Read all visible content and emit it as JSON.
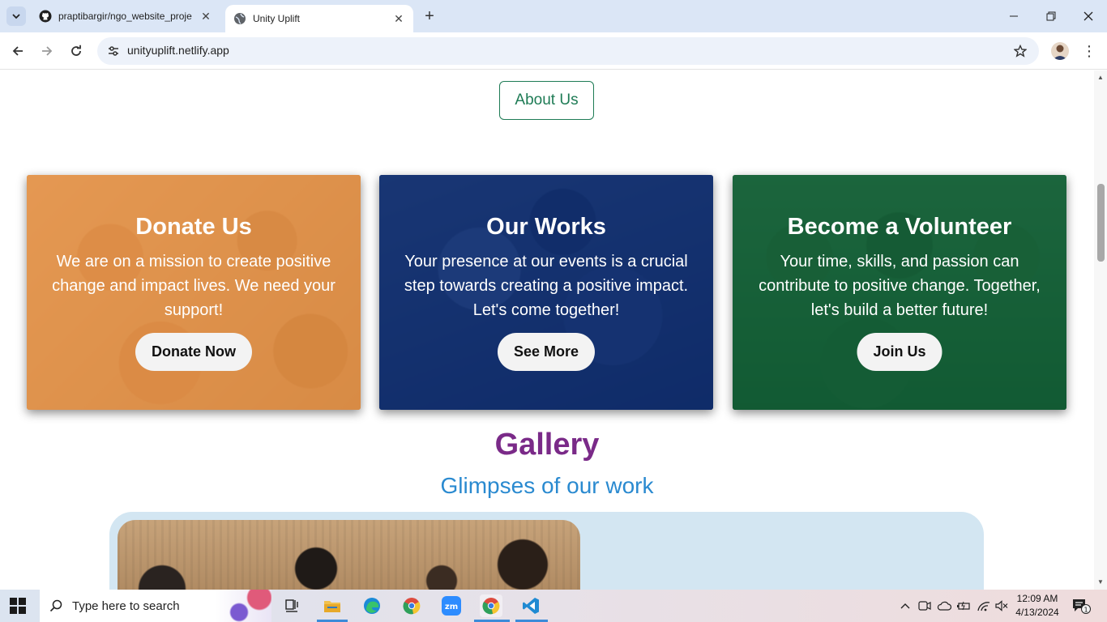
{
  "browser": {
    "tabs": [
      {
        "title": "praptibargir/ngo_website_proje",
        "favicon": "github-icon",
        "active": false
      },
      {
        "title": "Unity Uplift",
        "favicon": "globe-icon",
        "active": true
      }
    ],
    "url": "unityuplift.netlify.app"
  },
  "page": {
    "about_button": "About Us",
    "cards": [
      {
        "title": "Donate Us",
        "text": "We are on a mission to create positive change and impact lives. We need your support!",
        "button": "Donate Now",
        "tint": "#eb9646"
      },
      {
        "title": "Our Works",
        "text": "Your presence at our events is a crucial step towards creating a positive impact. Let's come together!",
        "button": "See More",
        "tint": "#0c2d73"
      },
      {
        "title": "Become a Volunteer",
        "text": "Your time, skills, and passion can contribute to positive change. Together, let's build a better future!",
        "button": "Join Us",
        "tint": "#0f6437"
      }
    ],
    "gallery": {
      "title": "Gallery",
      "subtitle": "Glimpses of our work",
      "title_color": "#7a2a88",
      "subtitle_color": "#2a8ad0"
    }
  },
  "taskbar": {
    "search_placeholder": "Type here to search",
    "apps": [
      "task-view-icon",
      "file-explorer-icon",
      "edge-icon",
      "chrome-icon",
      "zoom-icon",
      "chrome-icon",
      "vscode-icon"
    ],
    "time": "12:09 AM",
    "date": "4/13/2024",
    "notification_count": "1"
  }
}
